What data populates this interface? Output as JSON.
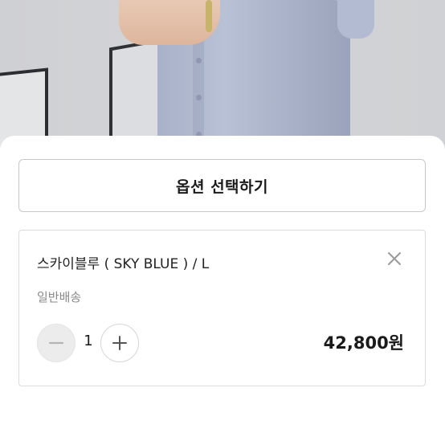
{
  "product_photo": {
    "alt": ""
  },
  "option_selector": {
    "label": "옵션 선택하기"
  },
  "selected_option": {
    "name": "스카이블루 ( SKY BLUE )  / L",
    "shipping": "일반배송",
    "quantity": "1",
    "price": "42,800원"
  },
  "icons": {
    "remove": "close-icon",
    "decrease": "minus-icon",
    "increase": "plus-icon"
  },
  "colors": {
    "sheet_bg": "#ffffff",
    "border": "#c8c8c8",
    "text_primary": "#1a1a1a",
    "text_secondary": "#8a8a8a",
    "minus_button_bg": "#ececec"
  }
}
